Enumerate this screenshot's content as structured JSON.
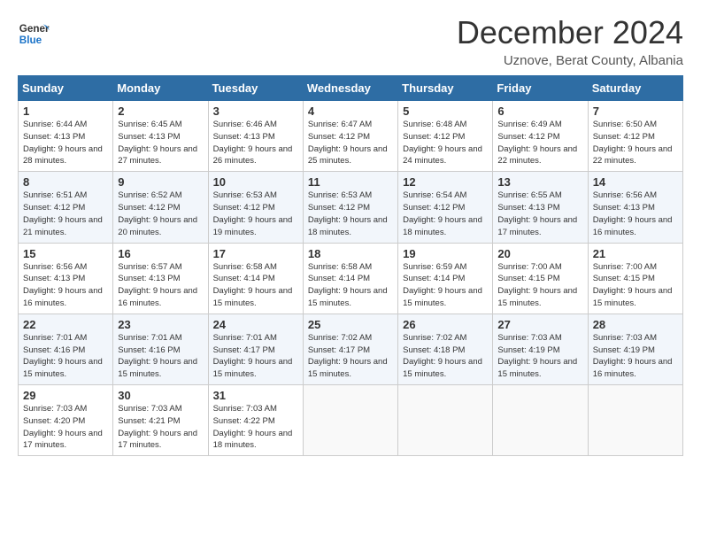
{
  "header": {
    "logo_line1": "General",
    "logo_line2": "Blue",
    "month": "December 2024",
    "location": "Uznove, Berat County, Albania"
  },
  "columns": [
    "Sunday",
    "Monday",
    "Tuesday",
    "Wednesday",
    "Thursday",
    "Friday",
    "Saturday"
  ],
  "weeks": [
    [
      {
        "day": 1,
        "rise": "6:44 AM",
        "set": "4:13 PM",
        "daylight": "9 hours and 28 minutes."
      },
      {
        "day": 2,
        "rise": "6:45 AM",
        "set": "4:13 PM",
        "daylight": "9 hours and 27 minutes."
      },
      {
        "day": 3,
        "rise": "6:46 AM",
        "set": "4:13 PM",
        "daylight": "9 hours and 26 minutes."
      },
      {
        "day": 4,
        "rise": "6:47 AM",
        "set": "4:12 PM",
        "daylight": "9 hours and 25 minutes."
      },
      {
        "day": 5,
        "rise": "6:48 AM",
        "set": "4:12 PM",
        "daylight": "9 hours and 24 minutes."
      },
      {
        "day": 6,
        "rise": "6:49 AM",
        "set": "4:12 PM",
        "daylight": "9 hours and 22 minutes."
      },
      {
        "day": 7,
        "rise": "6:50 AM",
        "set": "4:12 PM",
        "daylight": "9 hours and 22 minutes."
      }
    ],
    [
      {
        "day": 8,
        "rise": "6:51 AM",
        "set": "4:12 PM",
        "daylight": "9 hours and 21 minutes."
      },
      {
        "day": 9,
        "rise": "6:52 AM",
        "set": "4:12 PM",
        "daylight": "9 hours and 20 minutes."
      },
      {
        "day": 10,
        "rise": "6:53 AM",
        "set": "4:12 PM",
        "daylight": "9 hours and 19 minutes."
      },
      {
        "day": 11,
        "rise": "6:53 AM",
        "set": "4:12 PM",
        "daylight": "9 hours and 18 minutes."
      },
      {
        "day": 12,
        "rise": "6:54 AM",
        "set": "4:12 PM",
        "daylight": "9 hours and 18 minutes."
      },
      {
        "day": 13,
        "rise": "6:55 AM",
        "set": "4:13 PM",
        "daylight": "9 hours and 17 minutes."
      },
      {
        "day": 14,
        "rise": "6:56 AM",
        "set": "4:13 PM",
        "daylight": "9 hours and 16 minutes."
      }
    ],
    [
      {
        "day": 15,
        "rise": "6:56 AM",
        "set": "4:13 PM",
        "daylight": "9 hours and 16 minutes."
      },
      {
        "day": 16,
        "rise": "6:57 AM",
        "set": "4:13 PM",
        "daylight": "9 hours and 16 minutes."
      },
      {
        "day": 17,
        "rise": "6:58 AM",
        "set": "4:14 PM",
        "daylight": "9 hours and 15 minutes."
      },
      {
        "day": 18,
        "rise": "6:58 AM",
        "set": "4:14 PM",
        "daylight": "9 hours and 15 minutes."
      },
      {
        "day": 19,
        "rise": "6:59 AM",
        "set": "4:14 PM",
        "daylight": "9 hours and 15 minutes."
      },
      {
        "day": 20,
        "rise": "7:00 AM",
        "set": "4:15 PM",
        "daylight": "9 hours and 15 minutes."
      },
      {
        "day": 21,
        "rise": "7:00 AM",
        "set": "4:15 PM",
        "daylight": "9 hours and 15 minutes."
      }
    ],
    [
      {
        "day": 22,
        "rise": "7:01 AM",
        "set": "4:16 PM",
        "daylight": "9 hours and 15 minutes."
      },
      {
        "day": 23,
        "rise": "7:01 AM",
        "set": "4:16 PM",
        "daylight": "9 hours and 15 minutes."
      },
      {
        "day": 24,
        "rise": "7:01 AM",
        "set": "4:17 PM",
        "daylight": "9 hours and 15 minutes."
      },
      {
        "day": 25,
        "rise": "7:02 AM",
        "set": "4:17 PM",
        "daylight": "9 hours and 15 minutes."
      },
      {
        "day": 26,
        "rise": "7:02 AM",
        "set": "4:18 PM",
        "daylight": "9 hours and 15 minutes."
      },
      {
        "day": 27,
        "rise": "7:03 AM",
        "set": "4:19 PM",
        "daylight": "9 hours and 15 minutes."
      },
      {
        "day": 28,
        "rise": "7:03 AM",
        "set": "4:19 PM",
        "daylight": "9 hours and 16 minutes."
      }
    ],
    [
      {
        "day": 29,
        "rise": "7:03 AM",
        "set": "4:20 PM",
        "daylight": "9 hours and 17 minutes."
      },
      {
        "day": 30,
        "rise": "7:03 AM",
        "set": "4:21 PM",
        "daylight": "9 hours and 17 minutes."
      },
      {
        "day": 31,
        "rise": "7:03 AM",
        "set": "4:22 PM",
        "daylight": "9 hours and 18 minutes."
      },
      null,
      null,
      null,
      null
    ]
  ]
}
